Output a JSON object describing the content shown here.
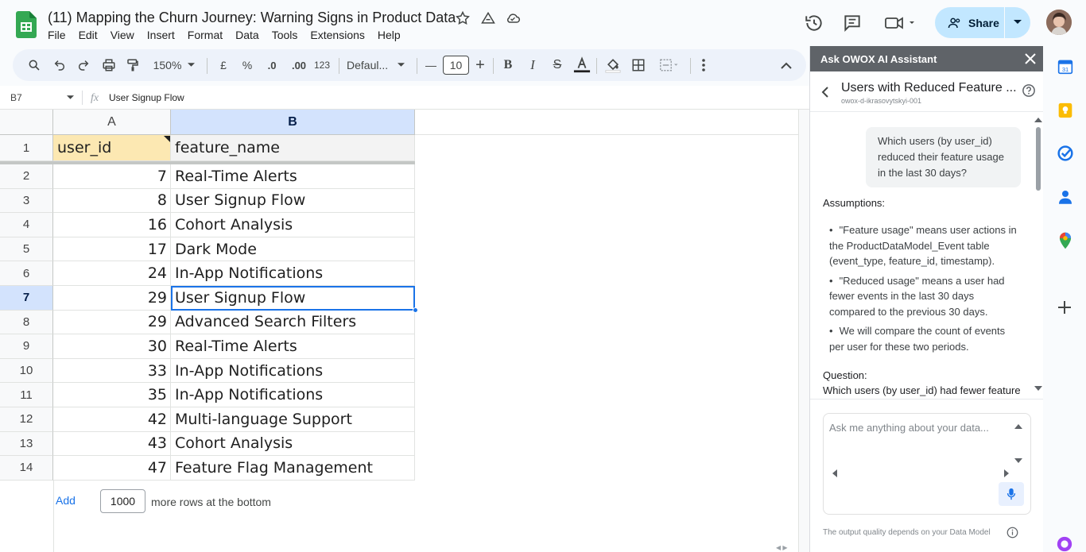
{
  "doc": {
    "title": "(11) Mapping the Churn Journey: Warning Signs in Product Data",
    "menu": [
      "File",
      "Edit",
      "View",
      "Insert",
      "Format",
      "Data",
      "Tools",
      "Extensions",
      "Help"
    ]
  },
  "header": {
    "share_label": "Share"
  },
  "toolbar": {
    "zoom": "150%",
    "currency": "£",
    "percent": "%",
    "dec_decrease": ".0",
    "dec_increase": ".00",
    "number_format": "123",
    "font": "Defaul...",
    "font_size": "10",
    "minus": "—",
    "plus": "+"
  },
  "formula_bar": {
    "cell_ref": "B7",
    "value": "User Signup Flow"
  },
  "sheet": {
    "columns": [
      "A",
      "B"
    ],
    "header_row": {
      "row": "1",
      "a": "user_id",
      "b": "feature_name"
    },
    "rows": [
      {
        "n": "2",
        "a": "7",
        "b": "Real-Time Alerts"
      },
      {
        "n": "3",
        "a": "8",
        "b": "User Signup Flow"
      },
      {
        "n": "4",
        "a": "16",
        "b": "Cohort Analysis"
      },
      {
        "n": "5",
        "a": "17",
        "b": "Dark Mode"
      },
      {
        "n": "6",
        "a": "24",
        "b": "In-App Notifications"
      },
      {
        "n": "7",
        "a": "29",
        "b": "User Signup Flow"
      },
      {
        "n": "8",
        "a": "29",
        "b": "Advanced Search Filters"
      },
      {
        "n": "9",
        "a": "30",
        "b": "Real-Time Alerts"
      },
      {
        "n": "10",
        "a": "33",
        "b": "In-App Notifications"
      },
      {
        "n": "11",
        "a": "35",
        "b": "In-App Notifications"
      },
      {
        "n": "12",
        "a": "42",
        "b": "Multi-language Support"
      },
      {
        "n": "13",
        "a": "43",
        "b": "Cohort Analysis"
      },
      {
        "n": "14",
        "a": "47",
        "b": "Feature Flag Management"
      }
    ],
    "selected_row": "7",
    "add_rows": {
      "add_label": "Add",
      "count": "1000",
      "suffix": "more rows at the bottom"
    }
  },
  "panel": {
    "header": "Ask OWOX AI Assistant",
    "title": "Users with Reduced Feature ...",
    "subtitle": "owox-d-ikrasovytskyi-001",
    "question": "Which users (by user_id) reduced their feature usage in the last 30 days?",
    "assumptions_label": "Assumptions:",
    "assumptions": [
      "\"Feature usage\" means user actions in the ProductDataModel_Event table (event_type, feature_id, timestamp).",
      "\"Reduced usage\" means a user had fewer events in the last 30 days compared to the previous 30 days.",
      "We will compare the count of events per user for these two periods."
    ],
    "question_label": "Question:",
    "question_text": "Which users (by user_id) had fewer feature",
    "input_placeholder": "Ask me anything about your data...",
    "footer": "The output quality depends on your Data Model"
  },
  "colors": {
    "accent": "#1a73e8",
    "share_bg": "#c2e7ff",
    "header_highlight": "#fce8b2",
    "selected_col": "#d3e3fd",
    "panel_header": "#5f6368"
  }
}
